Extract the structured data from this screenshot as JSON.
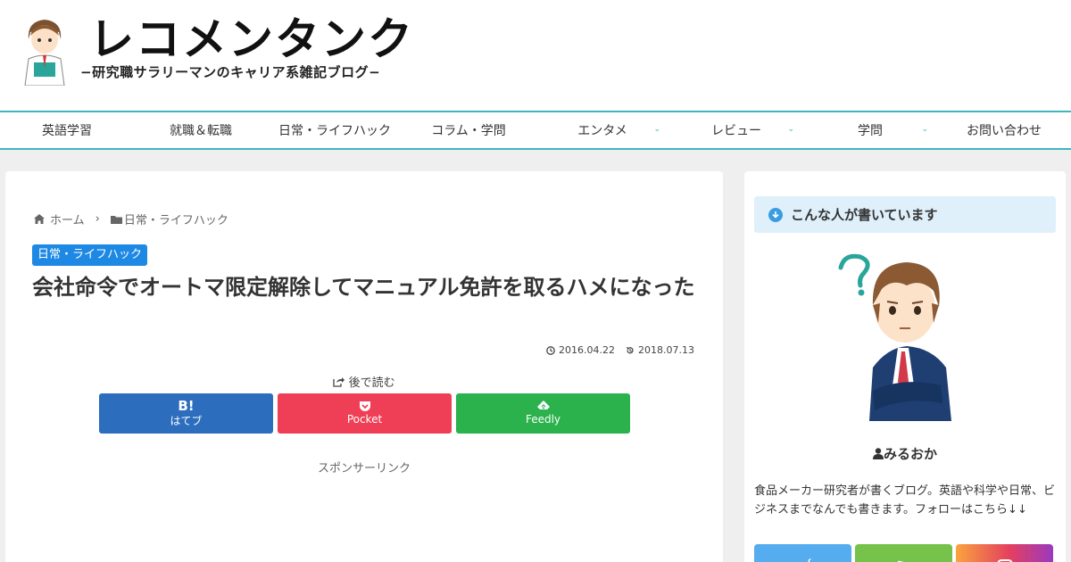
{
  "site": {
    "title": "レコメンタンク",
    "subtitle": "−研究職サラリーマンのキャリア系雑記ブログ−"
  },
  "nav": {
    "items": [
      {
        "label": "英語学習",
        "has_dropdown": false
      },
      {
        "label": "就職＆転職",
        "has_dropdown": false
      },
      {
        "label": "日常・ライフハック",
        "has_dropdown": false
      },
      {
        "label": "コラム・学問",
        "has_dropdown": false
      },
      {
        "label": "エンタメ",
        "has_dropdown": true
      },
      {
        "label": "レビュー",
        "has_dropdown": true
      },
      {
        "label": "学問",
        "has_dropdown": true
      },
      {
        "label": "お問い合わせ",
        "has_dropdown": false
      }
    ],
    "accent_color": "#3cb6c0"
  },
  "breadcrumb": {
    "home": "ホーム",
    "category": "日常・ライフハック"
  },
  "post": {
    "category": "日常・ライフハック",
    "title": "会社命令でオートマ限定解除してマニュアル免許を取るハメになった",
    "published": "2016.04.22",
    "updated": "2018.07.13",
    "read_later": "後で読む",
    "sponsor_label": "スポンサーリンク"
  },
  "share": {
    "hatebu": {
      "icon": "B!",
      "label": "はてブ",
      "color": "#2c6ebd"
    },
    "pocket": {
      "icon": "pocket-icon",
      "label": "Pocket",
      "color": "#ef3f56"
    },
    "feedly": {
      "icon": "feedly-icon",
      "label": "Feedly",
      "color": "#2bb24c"
    }
  },
  "sidebar": {
    "widget_title": "こんな人が書いています",
    "author_name": "みるおか",
    "author_desc": "食品メーカー研究者が書くブログ。英語や科学や日常、ビジネスまでなんでも書きます。フォローはこちら↓↓",
    "follow": [
      "twitter-icon",
      "rss-icon",
      "instagram-icon"
    ]
  }
}
